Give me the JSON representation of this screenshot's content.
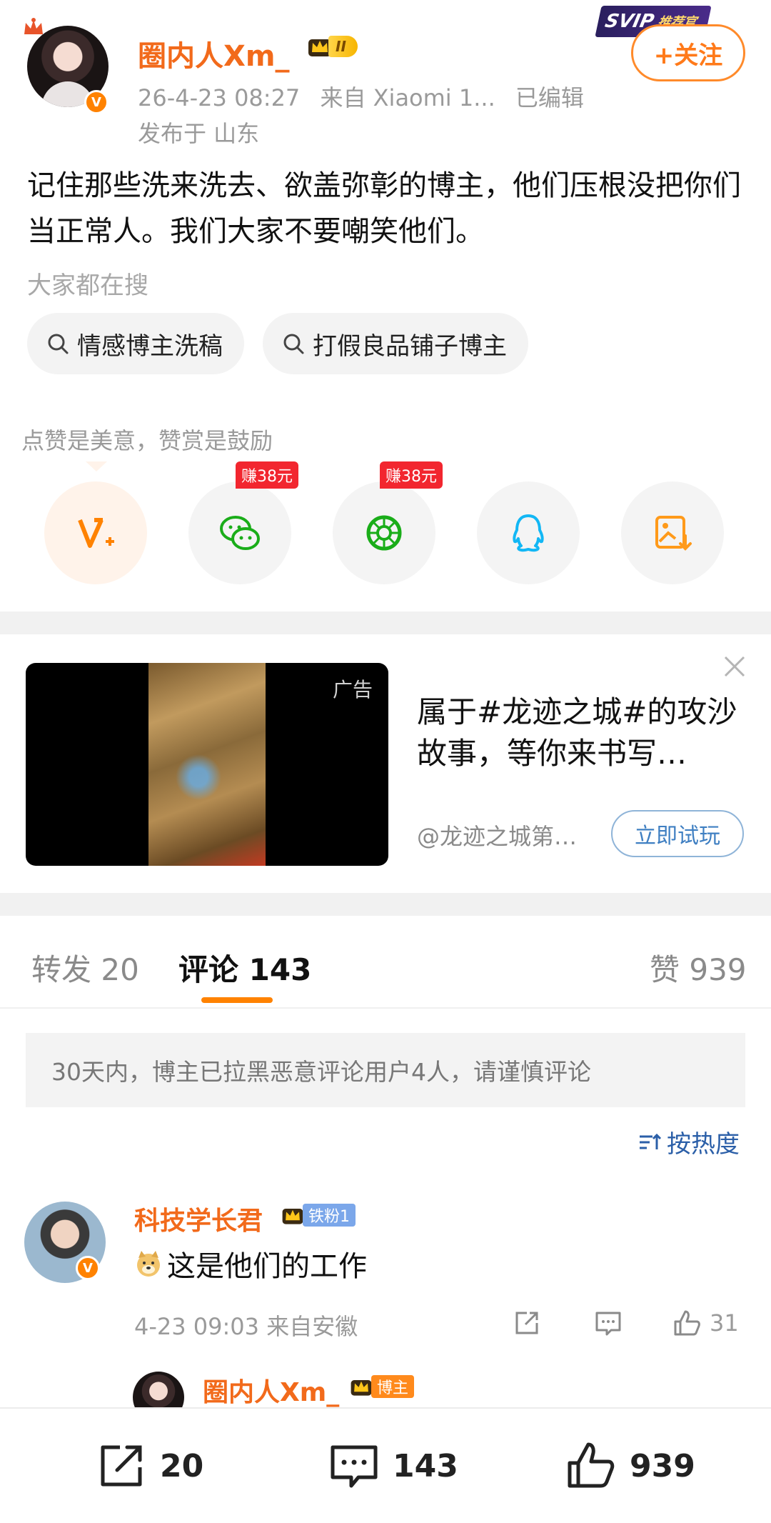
{
  "post": {
    "author_name": "圈内人Xm_",
    "author_level": "II",
    "timestamp": "26-4-23 08:27",
    "source": "来自 Xiaomi 1...",
    "edited": "已编辑",
    "location": "发布于 山东",
    "follow_label": "+关注",
    "svip_label": "SVIP",
    "svip_sub": "推荐官",
    "text": "记住那些洗来洗去、欲盖弥彰的博主，他们压根没把你们当正常人。我们大家不要嘲笑他们。"
  },
  "search": {
    "label": "大家都在搜",
    "chips": [
      "情感博主洗稿",
      "打假良品铺子博主"
    ]
  },
  "reward": {
    "text": "点赞是美意，赞赏是鼓励",
    "earn_tag": "赚38元"
  },
  "ad": {
    "label": "广告",
    "title": "属于#龙迹之城#的攻沙故事，等你来书写…",
    "source": "@龙迹之城第…",
    "cta": "立即试玩"
  },
  "tabs": {
    "repost": "转发 20",
    "comments": "评论 143",
    "likes": "赞 939"
  },
  "notice": "30天内，博主已拉黑恶意评论用户4人，请谨慎评论",
  "sort_label": "按热度",
  "comment": {
    "name": "科技学长君",
    "fan_tag": "铁粉1",
    "text": "这是他们的工作",
    "meta": "4-23 09:03  来自安徽",
    "likes": "31"
  },
  "reply": {
    "name": "圈内人Xm_",
    "owner_tag": "博主"
  },
  "bottom_bar": {
    "repost_count": "20",
    "comment_count": "143",
    "like_count": "939"
  },
  "colors": {
    "brand_orange": "#ff8200",
    "name_orange": "#f26a1b",
    "link_blue": "#2b5fa8"
  }
}
